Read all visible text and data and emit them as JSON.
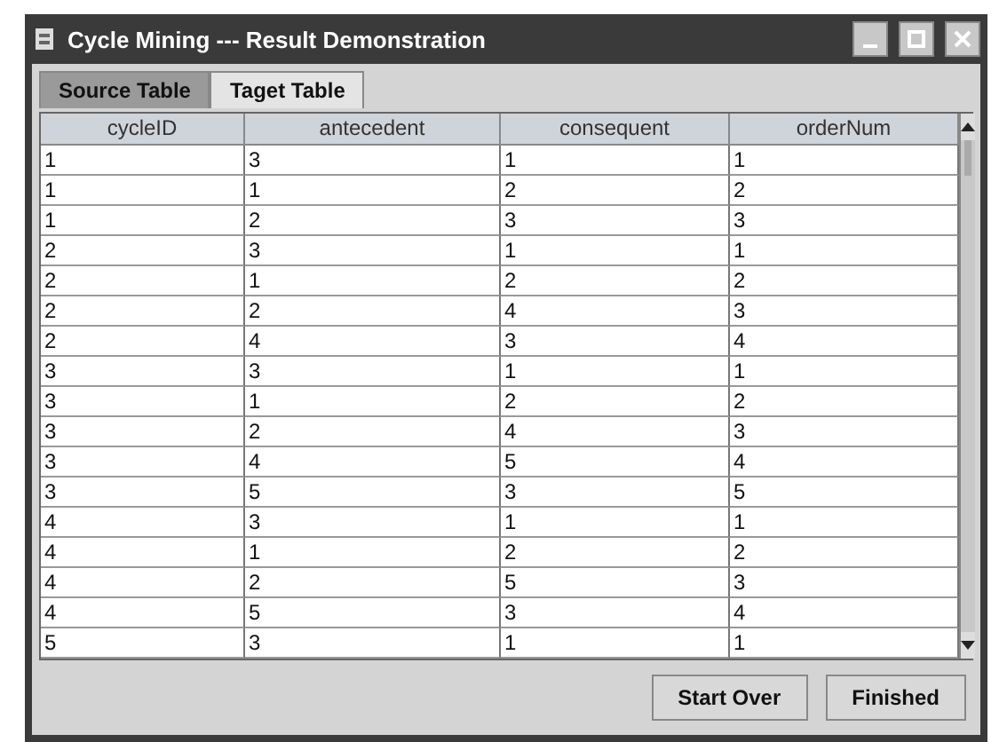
{
  "window": {
    "title": "Cycle Mining  --- Result Demonstration"
  },
  "tabs": [
    {
      "label": "Source Table",
      "selected": false
    },
    {
      "label": "Taget Table",
      "selected": true
    }
  ],
  "table": {
    "columns": [
      "cycleID",
      "antecedent",
      "consequent",
      "orderNum"
    ],
    "rows": [
      [
        "1",
        "3",
        "1",
        "1"
      ],
      [
        "1",
        "1",
        "2",
        "2"
      ],
      [
        "1",
        "2",
        "3",
        "3"
      ],
      [
        "2",
        "3",
        "1",
        "1"
      ],
      [
        "2",
        "1",
        "2",
        "2"
      ],
      [
        "2",
        "2",
        "4",
        "3"
      ],
      [
        "2",
        "4",
        "3",
        "4"
      ],
      [
        "3",
        "3",
        "1",
        "1"
      ],
      [
        "3",
        "1",
        "2",
        "2"
      ],
      [
        "3",
        "2",
        "4",
        "3"
      ],
      [
        "3",
        "4",
        "5",
        "4"
      ],
      [
        "3",
        "5",
        "3",
        "5"
      ],
      [
        "4",
        "3",
        "1",
        "1"
      ],
      [
        "4",
        "1",
        "2",
        "2"
      ],
      [
        "4",
        "2",
        "5",
        "3"
      ],
      [
        "4",
        "5",
        "3",
        "4"
      ],
      [
        "5",
        "3",
        "1",
        "1"
      ]
    ]
  },
  "buttons": [
    "Start Over",
    "Finished"
  ]
}
